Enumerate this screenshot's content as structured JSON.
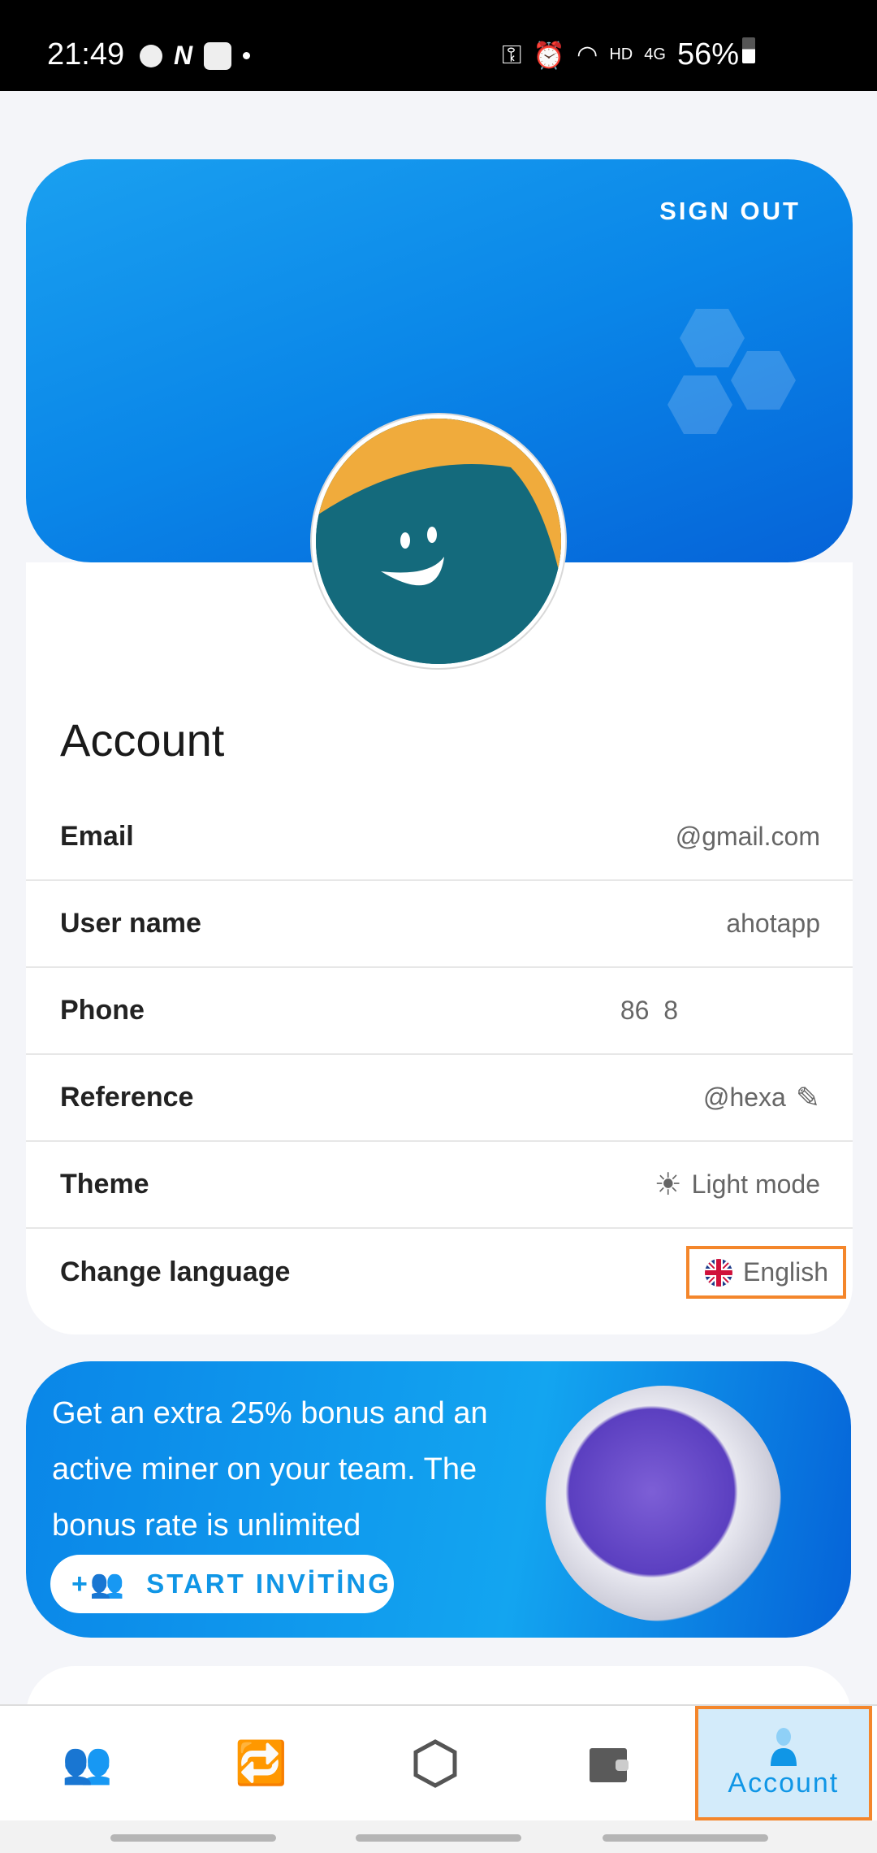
{
  "status_bar": {
    "time": "21:49",
    "network": "HD",
    "signal": "4G",
    "battery": "56%"
  },
  "header": {
    "sign_out_label": "SIGN OUT"
  },
  "account": {
    "title": "Account",
    "rows": [
      {
        "label": "Email",
        "value": "@gmail.com"
      },
      {
        "label": "User name",
        "value": "ahotapp"
      },
      {
        "label": "Phone",
        "value": "86  8"
      },
      {
        "label": "Reference",
        "value": "@hexa"
      },
      {
        "label": "Theme",
        "value": "Light mode"
      },
      {
        "label": "Change language",
        "value": "English"
      }
    ]
  },
  "banner": {
    "text": "Get an extra 25% bonus and an active miner on your team. The bonus rate is unlimited",
    "button_label": "START INVİTİNG"
  },
  "bottom_nav": {
    "items": [
      {
        "icon": "team-icon"
      },
      {
        "icon": "exchange-icon"
      },
      {
        "icon": "hexagon-icon"
      },
      {
        "icon": "wallet-icon"
      },
      {
        "icon": "account-icon",
        "label": "Account",
        "active": true
      }
    ]
  },
  "colors": {
    "accent": "#1096e6",
    "highlight": "#f4862b",
    "active_tab_bg": "#d3ebfa"
  }
}
